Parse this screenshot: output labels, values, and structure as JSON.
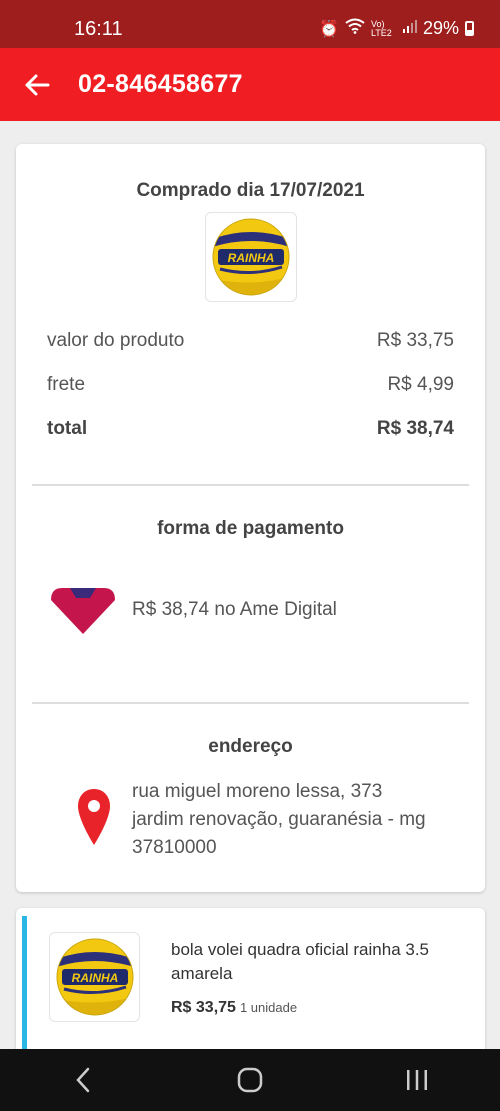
{
  "status_bar": {
    "time": "16:11",
    "network": "Vo) LTE2",
    "battery": "29%"
  },
  "app_bar": {
    "title": "02-846458677"
  },
  "order": {
    "bought_label": "Comprado dia 17/07/2021",
    "ball_brand": "RAINHA",
    "product_value_label": "valor do produto",
    "product_value": "R$ 33,75",
    "shipping_label": "frete",
    "shipping_value": "R$ 4,99",
    "total_label": "total",
    "total_value": "R$ 38,74"
  },
  "payment": {
    "title": "forma de pagamento",
    "text": "R$ 38,74 no Ame Digital"
  },
  "address": {
    "title": "endereço",
    "line1": "rua miguel moreno lessa, 373",
    "line2": "jardim renovação, guaranésia - mg",
    "line3": "37810000"
  },
  "item": {
    "name": "bola volei quadra oficial rainha 3.5 amarela",
    "price": "R$ 33,75",
    "quantity": "1 unidade",
    "ball_brand": "RAINHA"
  },
  "colors": {
    "brand_red": "#f01e23",
    "status_red": "#9e1e1e",
    "accent_blue": "#2bb7e6",
    "ame_pink": "#c4154c"
  }
}
